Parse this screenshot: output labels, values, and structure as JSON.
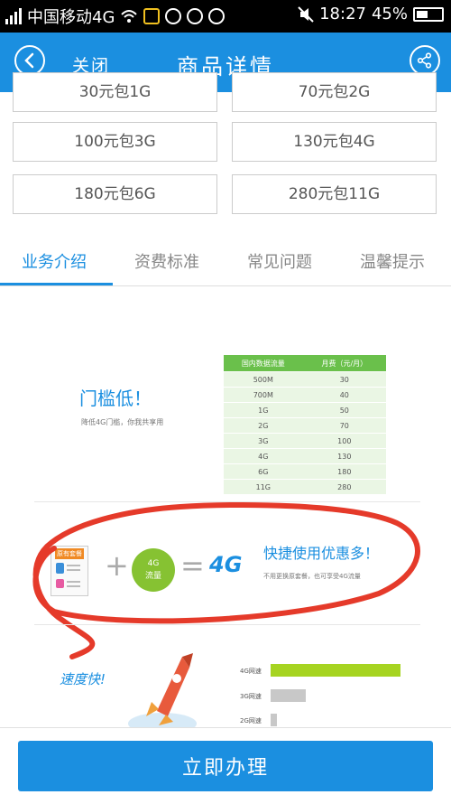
{
  "status_bar": {
    "carrier": "中国移动4G",
    "time": "18:27",
    "battery": "45%"
  },
  "app_bar": {
    "close_label": "关闭",
    "title": "商品详情"
  },
  "packages": [
    {
      "label": "30元包1G"
    },
    {
      "label": "70元包2G"
    },
    {
      "label": "100元包3G"
    },
    {
      "label": "130元包4G"
    },
    {
      "label": "180元包6G"
    },
    {
      "label": "280元包11G"
    }
  ],
  "tabs": [
    {
      "label": "业务介绍"
    },
    {
      "label": "资费标准"
    },
    {
      "label": "常见问题"
    },
    {
      "label": "温馨提示"
    }
  ],
  "intro": {
    "section1_title": "门槛低！",
    "section1_sub": "降低4G门槛，你我共享用",
    "table_headers": [
      "国内数据流量",
      "月费（元/月）"
    ],
    "table_rows": [
      [
        "500M",
        "30"
      ],
      [
        "700M",
        "40"
      ],
      [
        "1G",
        "50"
      ],
      [
        "2G",
        "70"
      ],
      [
        "3G",
        "100"
      ],
      [
        "4G",
        "130"
      ],
      [
        "6G",
        "180"
      ],
      [
        "11G",
        "280"
      ]
    ],
    "plan_card_label": "原有套餐",
    "badge_line1": "4G",
    "badge_line2": "流量",
    "logo_4g": "4G",
    "section2_title": "快捷使用优惠多！",
    "section2_sub": "不用更换原套餐，也可享受4G流量",
    "section3_title": "速度快!",
    "speeds": [
      {
        "label": "4G网速",
        "fraction": 1.0
      },
      {
        "label": "3G网速",
        "fraction": 0.27
      },
      {
        "label": "2G网速",
        "fraction": 0.05
      }
    ]
  },
  "footer": {
    "cta_label": "立即办理"
  },
  "colors": {
    "brand_blue": "#1b8fe0",
    "table_green": "#6ac04b",
    "speed_green": "#a6d421",
    "annotation_red": "#e53a2a"
  }
}
